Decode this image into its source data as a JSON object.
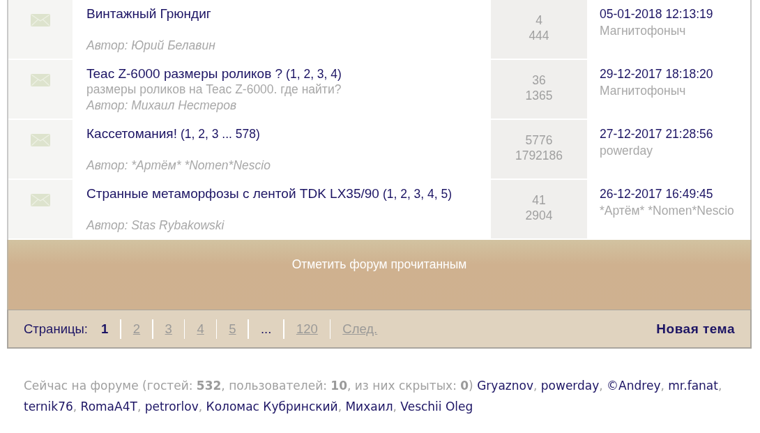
{
  "topics": [
    {
      "title": "Винтажный Грюндиг",
      "author": "Автор: Юрий Белавин",
      "stats": [
        "4",
        "444"
      ],
      "last_post": {
        "date": "05-01-2018 12:13:19",
        "user": "Магнитофоныч"
      }
    },
    {
      "title": "Teac Z-6000 размеры роликов ?",
      "pages": "(1, 2, 3, 4)",
      "description": "размеры роликов на Teac Z-6000. где найти?",
      "author": "Автор: Михаил Нестеров",
      "stats": [
        "36",
        "1365"
      ],
      "last_post": {
        "date": "29-12-2017 18:18:20",
        "user": "Магнитофоныч"
      }
    },
    {
      "title": "Кассетомания!",
      "pages": "(1, 2, 3 ... 578)",
      "author": "Автор: *Артём* *Nomen*Nescio",
      "stats": [
        "5776",
        "1792186"
      ],
      "last_post": {
        "date": "27-12-2017 21:28:56",
        "user": "powerday"
      }
    },
    {
      "title": "Странные метаморфозы с лентой TDK LX35/90",
      "pages": "(1, 2, 3, 4, 5)",
      "author": "Автор: Stas Rybakowski",
      "stats": [
        "41",
        "2904"
      ],
      "last_post": {
        "date": "26-12-2017 16:49:45",
        "user": "*Артём* *Nomen*Nescio"
      }
    }
  ],
  "mark_read": "Отметить форум прочитанным",
  "pagination": {
    "label": "Страницы:",
    "items": [
      {
        "kind": "page",
        "label": "1",
        "selected": true
      },
      {
        "kind": "page",
        "label": "2",
        "selected": false
      },
      {
        "kind": "page",
        "label": "3",
        "selected": false
      },
      {
        "kind": "page",
        "label": "4",
        "selected": false
      },
      {
        "kind": "page",
        "label": "5",
        "selected": false
      },
      {
        "kind": "gap",
        "label": "...",
        "selected": false
      },
      {
        "kind": "page",
        "label": "120",
        "selected": false
      },
      {
        "kind": "next",
        "label": "След.",
        "selected": false
      }
    ],
    "new_topic": "Новая тема"
  },
  "online": {
    "summary": "Сейчас на форуме (гостей: **532**, пользователей: **10**, из них скрытых: **0**)",
    "users": [
      "Gryaznov",
      "powerday",
      "©Andrey",
      "mr.fanat",
      "ternik76",
      "RomaA4T",
      "petrorlov",
      "Коломас Кубринский",
      "Михаил",
      "Veschii Oleg"
    ],
    "separator": ","
  }
}
